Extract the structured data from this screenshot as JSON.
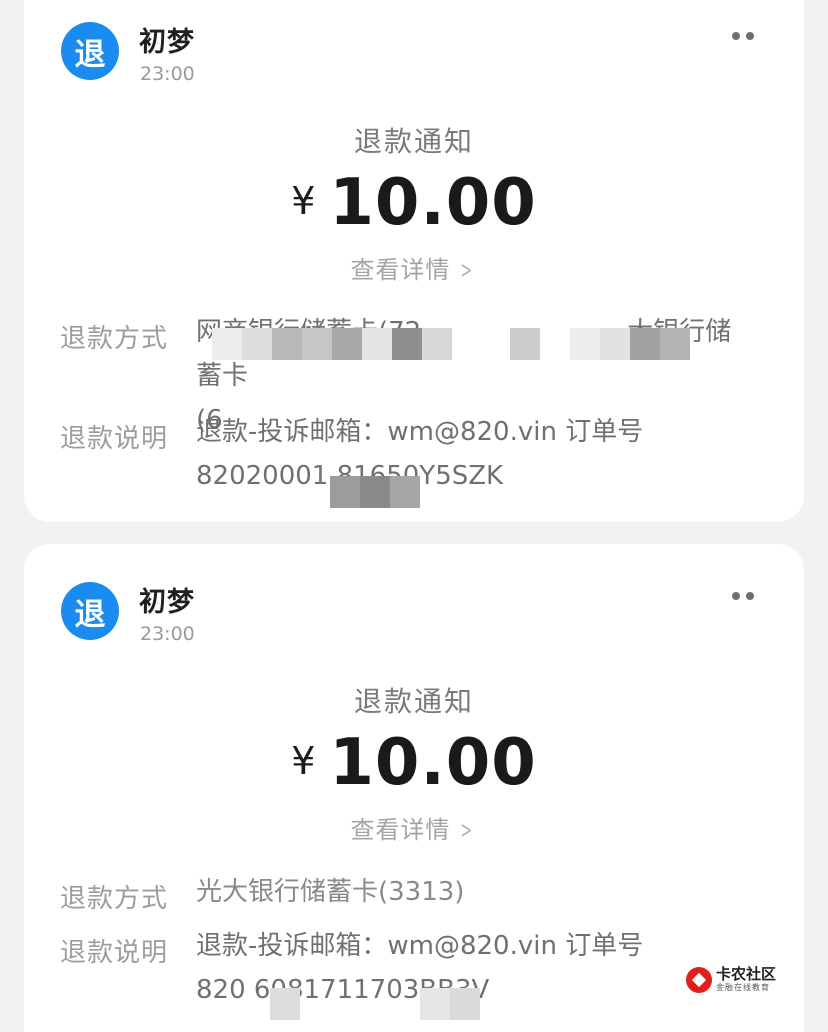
{
  "cards": [
    {
      "avatar_char": "退",
      "sender": "初梦",
      "time": "23:00",
      "title": "退款通知",
      "currency": "¥",
      "amount": "10.00",
      "detail_link": "查看详情",
      "method_label": "退款方式",
      "method_value_line1": "网商银行储蓄卡(72",
      "method_value_line1b": "，",
      "method_value_line1c": "大银行储蓄卡",
      "method_value_line2": "(6",
      "desc_label": "退款说明",
      "desc_value_line1": "退款-投诉邮箱：wm@820.vin 订单号",
      "desc_value_line2": "82020001 81650Y5SZK"
    },
    {
      "avatar_char": "退",
      "sender": "初梦",
      "time": "23:00",
      "title": "退款通知",
      "currency": "¥",
      "amount": "10.00",
      "detail_link": "查看详情",
      "method_label": "退款方式",
      "method_value_line1": "光大银行储蓄卡(3313)",
      "desc_label": "退款说明",
      "desc_value_line1": "退款-投诉邮箱：wm@820.vin 订单号",
      "desc_value_line2": "820 6081711703BB3V"
    }
  ],
  "icons": {
    "more": "more-dots-icon",
    "chevron": "chevron-right-icon"
  },
  "watermark": {
    "main": "卡农社区",
    "sub": "金融在线教育"
  },
  "colors": {
    "avatar": "#1a8cf0",
    "card": "#ffffff",
    "background": "#f2f2f2",
    "watermark_red": "#e21d1d"
  }
}
